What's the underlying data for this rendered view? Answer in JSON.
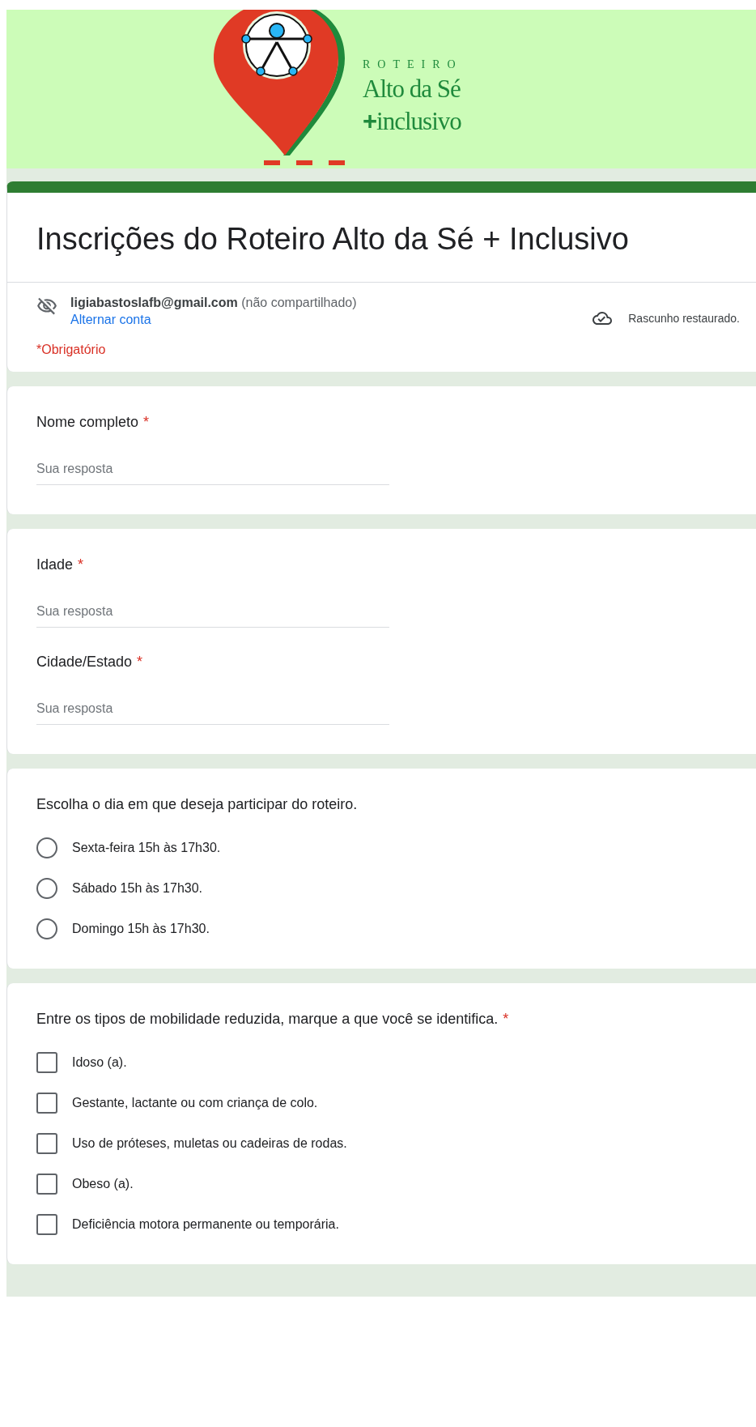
{
  "banner": {
    "kicker": "ROTEIRO",
    "title": "Alto da Sé",
    "plus": "+",
    "subtitle": "inclusivo"
  },
  "header": {
    "title": "Inscrições do Roteiro Alto da Sé + Inclusivo",
    "account": "**ligiabastoslafb@gmail.com** (não compartilhado)",
    "switch_link": "Alternar conta",
    "draft_status": "Rascunho restaurado.",
    "required_note": "*Obrigatório"
  },
  "cards": [
    {
      "questions": [
        {
          "kind": "text",
          "label": "Nome completo",
          "required_mark": "*",
          "placeholder": "Sua resposta"
        }
      ]
    },
    {
      "questions": [
        {
          "kind": "text",
          "label": "Idade",
          "required_mark": "*",
          "placeholder": "Sua resposta"
        },
        {
          "kind": "text",
          "label": "Cidade/Estado",
          "required_mark": "*",
          "placeholder": "Sua resposta"
        }
      ]
    },
    {
      "questions": [
        {
          "kind": "radio",
          "label": "Escolha o dia em que deseja participar do roteiro.",
          "options": [
            {
              "label": "Sexta-feira 15h às 17h30.",
              "selected": false
            },
            {
              "label": "Sábado 15h às 17h30.",
              "selected": false
            },
            {
              "label": "Domingo 15h às 17h30.",
              "selected": false
            }
          ]
        }
      ]
    },
    {
      "questions": [
        {
          "kind": "checkbox",
          "label": "Entre os tipos de mobilidade reduzida, marque a que você se identifica.",
          "required_mark": "*",
          "options": [
            {
              "label": "Idoso (a).",
              "checked": false
            },
            {
              "label": "Gestante, lactante ou com criança de colo.",
              "checked": false
            },
            {
              "label": "Uso de próteses, muletas ou cadeiras de rodas.",
              "checked": false
            },
            {
              "label": "Obeso (a).",
              "checked": false
            },
            {
              "label": "Deficiência motora permanente ou temporária.",
              "checked": false
            }
          ]
        }
      ]
    }
  ]
}
